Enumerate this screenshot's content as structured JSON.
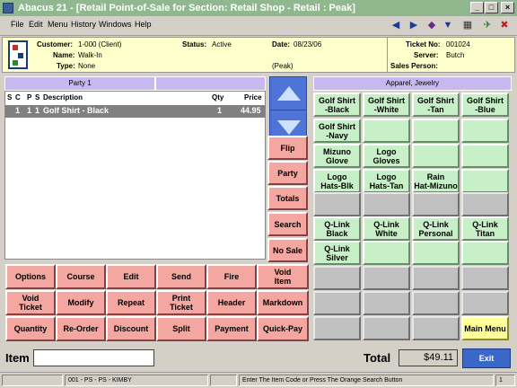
{
  "window": {
    "title": "Abacus 21 - [Retail Point-of-Sale for Section: Retail Shop - Retail : Peak]",
    "min": "_",
    "max": "□",
    "close": "×"
  },
  "menu": [
    "File",
    "Edit",
    "Menu",
    "History",
    "Windows",
    "Help"
  ],
  "header": {
    "customer_label": "Customer:",
    "customer": "1-000 (Client)",
    "name_label": "Name:",
    "name": "Walk-In",
    "type_label": "Type:",
    "type": "None",
    "status_label": "Status:",
    "status": "Active",
    "date_label": "Date:",
    "date": "08/23/06",
    "period": "(Peak)",
    "ticket_label": "Ticket No:",
    "ticket": "001024",
    "server_label": "Server:",
    "server": "Butch",
    "salesperson_label": "Sales Person:",
    "salesperson": ""
  },
  "party": {
    "label": "Party 1",
    "label2": ""
  },
  "grid": {
    "headers": {
      "s": "S",
      "c": "C",
      "p": "P",
      "s2": "S",
      "desc": "Description",
      "qty": "Qty",
      "price": "Price"
    },
    "rows": [
      {
        "s": "",
        "c": "1",
        "p": "1",
        "s2": "1",
        "desc": "Golf Shirt - Black",
        "qty": "1",
        "price": "44.95"
      }
    ]
  },
  "side_buttons": [
    "Flip",
    "Party",
    "Totals",
    "Search",
    "No Sale"
  ],
  "func_buttons": [
    [
      "Options",
      "Course",
      "Edit",
      "Send",
      "Fire",
      "Void\nItem"
    ],
    [
      "Void\nTicket",
      "Modify",
      "Repeat",
      "Print\nTicket",
      "Header",
      "Markdown"
    ],
    [
      "Quantity",
      "Re-Order",
      "Discount",
      "Split",
      "Payment",
      "Quick-Pay"
    ]
  ],
  "apparel": {
    "title": "Apparel, Jewelry",
    "items": [
      "Golf Shirt\n-Black",
      "Golf Shirt\n-White",
      "Golf Shirt\n-Tan",
      "Golf Shirt\n-Blue",
      "Golf Shirt\n-Navy",
      "",
      "",
      "",
      "Mizuno\nGlove",
      "Logo\nGloves",
      "",
      "",
      "Logo\nHats-Blk",
      "Logo\nHats-Tan",
      "Rain\nHat-Mizuno",
      "",
      "",
      "",
      "",
      "",
      "Q-Link\nBlack",
      "Q-Link\nWhite",
      "Q-Link\nPersonal",
      "Q-Link\nTitan",
      "Q-Link\nSilver",
      "",
      "",
      ""
    ],
    "main_menu": "Main Menu"
  },
  "bottom": {
    "item_label": "Item",
    "item_value": "",
    "total_label": "Total",
    "total": "$49.11",
    "exit": "Exit"
  },
  "status": {
    "seg1": "",
    "seg2": "001 - PS - PS - KIMBY",
    "seg3": "",
    "seg4": "Enter The Item Code or Press The Orange Search Button",
    "seg5": "1"
  }
}
